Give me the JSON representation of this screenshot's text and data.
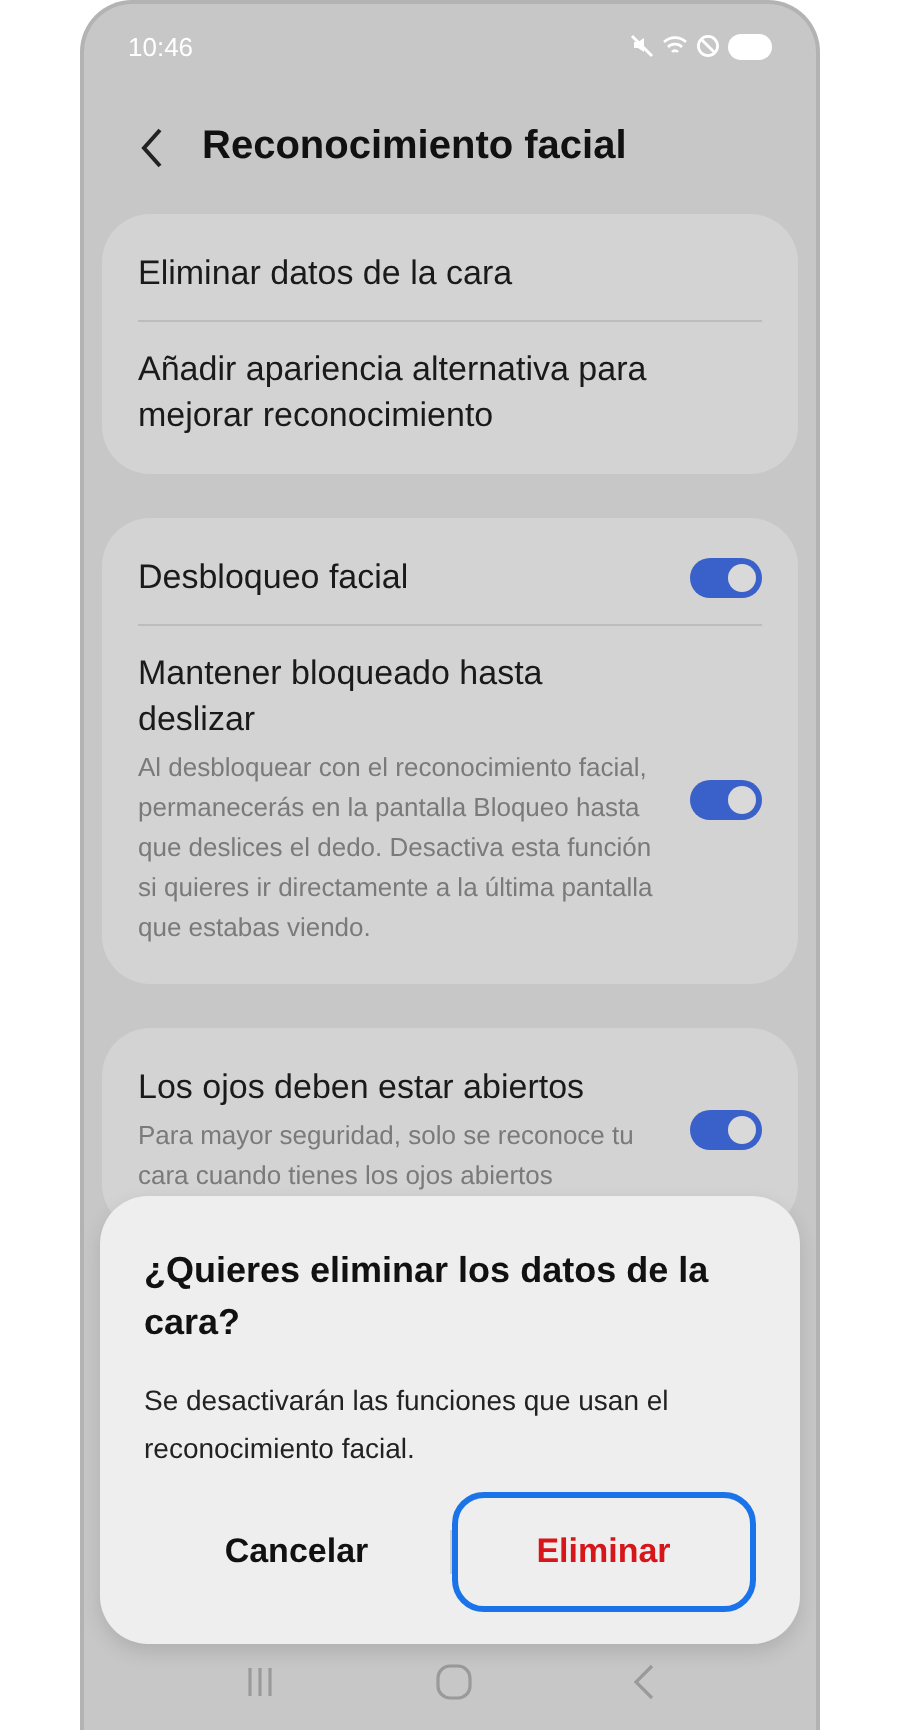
{
  "status_bar": {
    "time": "10:46"
  },
  "header": {
    "title": "Reconocimiento facial"
  },
  "sections": [
    {
      "rows": [
        {
          "title": "Eliminar datos de la cara"
        },
        {
          "title": "Añadir apariencia alternativa para mejorar reconocimiento"
        }
      ]
    },
    {
      "rows": [
        {
          "title": "Desbloqueo facial",
          "on": true
        },
        {
          "title": "Mantener bloqueado hasta deslizar",
          "description": "Al desbloquear con el reconocimiento facial, permanecerás en la pantalla Bloqueo hasta que deslices el dedo. Desactiva esta función si quieres ir directamente a la última pantalla que estabas viendo.",
          "on": true
        }
      ]
    },
    {
      "rows": [
        {
          "title": "Los ojos deben estar abiertos",
          "description": "Para mayor seguridad, solo se reconoce tu cara cuando tienes los ojos abiertos",
          "on": true
        }
      ]
    }
  ],
  "dialog": {
    "title": "¿Quieres eliminar los datos de la cara?",
    "message": "Se desactivarán las funciones que usan el reconocimiento facial.",
    "buttons": [
      {
        "label": "Cancelar",
        "kind": "cancel",
        "focused": false
      },
      {
        "label": "Eliminar",
        "kind": "destructive",
        "focused": true
      }
    ]
  }
}
